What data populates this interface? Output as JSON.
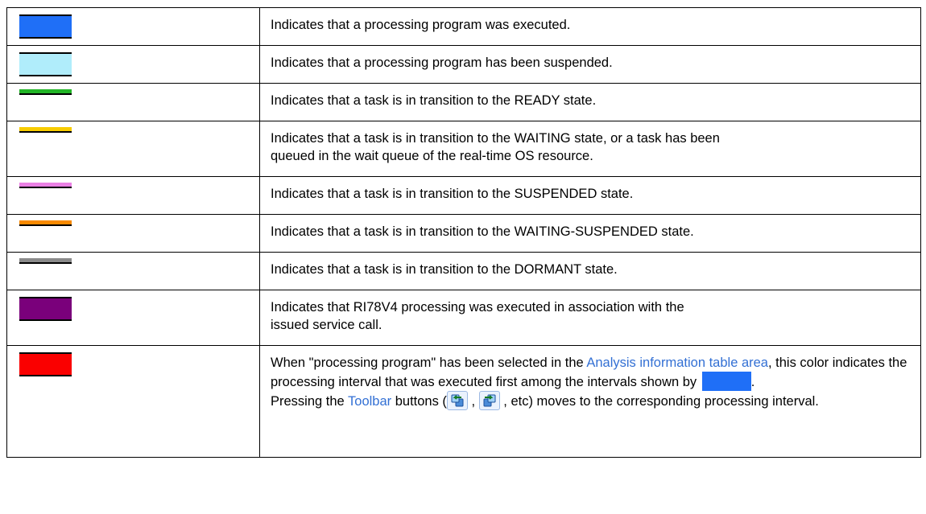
{
  "rows": [
    {
      "id": "r1",
      "kind": "block",
      "color": "#1f6ff7",
      "text": "Indicates that a processing program was executed."
    },
    {
      "id": "r2",
      "kind": "block",
      "color": "#b0edfb",
      "text": "Indicates that a processing program has been suspended."
    },
    {
      "id": "r3",
      "kind": "line",
      "color": "#22b527",
      "text": "Indicates that a task is in transition to the READY state."
    },
    {
      "id": "r4",
      "kind": "line",
      "color": "#f7cc00",
      "text_line1": "Indicates that a task is in transition to the WAITING state, or a task has been",
      "text_line2": "queued in the wait queue of the real-time OS resource."
    },
    {
      "id": "r5",
      "kind": "line",
      "color": "#ea80e4",
      "text": "Indicates that a task is in transition to the SUSPENDED state."
    },
    {
      "id": "r6",
      "kind": "line",
      "color": "#f98a00",
      "text": "Indicates that a task is in transition to the WAITING-SUSPENDED state."
    },
    {
      "id": "r7",
      "kind": "line",
      "color": "#8a8a8a",
      "text": "Indicates that a task is in transition to the DORMANT state."
    },
    {
      "id": "r8",
      "kind": "block",
      "color": "#7a007b",
      "text_line1": "Indicates that RI78V4 processing was executed in association with the",
      "text_line2": "issued service call."
    },
    {
      "id": "r9",
      "kind": "block",
      "color": "#fa0000",
      "p1_a": "When \"processing program\" has been selected in the ",
      "p1_link": "Analysis information table area",
      "p1_b": ", this color indicates the processing interval that was executed first among the intervals shown by ",
      "p1_end": ".",
      "inline_swatch_color": "#1f6ff7",
      "p2_a": "Pressing the ",
      "p2_link": "Toolbar",
      "p2_b": " buttons (",
      "p2_sep": " , ",
      "p2_c": " , etc) moves to the corresponding processing interval.",
      "btn1_icon": "previous-interval-icon",
      "btn2_icon": "next-interval-icon"
    }
  ]
}
